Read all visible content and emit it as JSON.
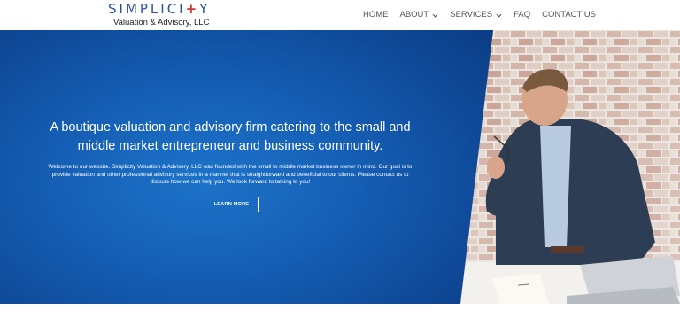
{
  "brand": {
    "name_part1": "SIMPLICI",
    "name_cross": "+",
    "name_part2": "Y",
    "tagline": "Valuation & Advisory, LLC",
    "cross_color": "#d6332e",
    "brand_color": "#2d4fa3"
  },
  "nav": {
    "items": [
      {
        "label": "HOME",
        "has_dropdown": false
      },
      {
        "label": "ABOUT",
        "has_dropdown": true
      },
      {
        "label": "SERVICES",
        "has_dropdown": true
      },
      {
        "label": "FAQ",
        "has_dropdown": false
      },
      {
        "label": "CONTACT US",
        "has_dropdown": false
      }
    ]
  },
  "hero": {
    "headline": "A boutique valuation and advisory firm catering to the small and middle market entrepreneur and business community.",
    "body": "Welcome to our website. Simplicity Valuation & Advisory, LLC was founded with the small to middle market business owner in mind. Our goal is to provide valuation and other professional advisory services in a manner that is straightforward and beneficial to our clients. Please contact us to discuss how we can help you. We look forward to talking to you!",
    "cta_label": "LEARN MORE",
    "gradient_colors": [
      "#1c73c9",
      "#0b3d86"
    ]
  }
}
